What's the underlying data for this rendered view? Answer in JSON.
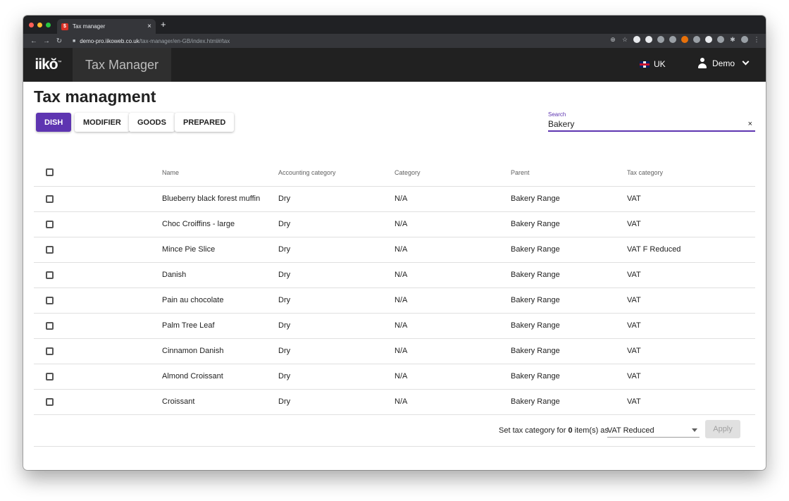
{
  "browser": {
    "tab_title": "Tax manager",
    "tab_close": "×",
    "new_tab": "+",
    "url_host": "demo-pro.iikoweb.co.uk",
    "url_path": "/tax-manager/en-GB/index.html#/tax"
  },
  "app": {
    "logo": "iikŏ",
    "logo_tm": "™",
    "title": "Tax Manager",
    "locale": "UK",
    "user": "Demo"
  },
  "page": {
    "title": "Tax managment",
    "tabs": [
      "DISH",
      "MODIFIER",
      "GOODS",
      "PREPARED"
    ],
    "active_tab": "DISH",
    "search": {
      "label": "Search",
      "value": "Bakery",
      "clear": "×"
    }
  },
  "table": {
    "headers": [
      "Name",
      "Accounting category",
      "Category",
      "Parent",
      "Tax category"
    ],
    "rows": [
      [
        "Blueberry black forest muffin",
        "Dry",
        "N/A",
        "Bakery Range",
        "VAT"
      ],
      [
        "Choc Croiffins - large",
        "Dry",
        "N/A",
        "Bakery Range",
        "VAT"
      ],
      [
        "Mince Pie Slice",
        "Dry",
        "N/A",
        "Bakery Range",
        "VAT F Reduced"
      ],
      [
        "Danish",
        "Dry",
        "N/A",
        "Bakery Range",
        "VAT"
      ],
      [
        "Pain au chocolate",
        "Dry",
        "N/A",
        "Bakery Range",
        "VAT"
      ],
      [
        "Palm Tree Leaf",
        "Dry",
        "N/A",
        "Bakery Range",
        "VAT"
      ],
      [
        "Cinnamon Danish",
        "Dry",
        "N/A",
        "Bakery Range",
        "VAT"
      ],
      [
        "Almond Croissant",
        "Dry",
        "N/A",
        "Bakery Range",
        "VAT"
      ],
      [
        "Croissant",
        "Dry",
        "N/A",
        "Bakery Range",
        "VAT"
      ]
    ]
  },
  "footer": {
    "prefix": "Set tax category for",
    "count": "0",
    "suffix": "item(s) as",
    "selected_tax": "VAT Reduced",
    "apply_label": "Apply"
  },
  "colors": {
    "accent": "#5e35b1",
    "appbar": "#212121"
  }
}
